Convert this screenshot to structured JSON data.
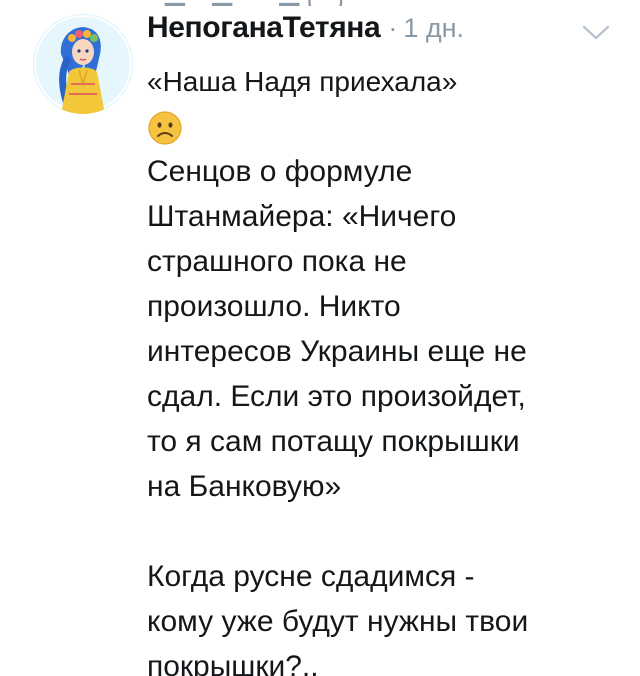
{
  "tweet": {
    "author_name": "НепоганаТетяна",
    "separator": "·",
    "time": "1 дн.",
    "first_line": "«Наша Надя приехала»",
    "emoji_icon": "sad-face-emoji",
    "quote_lines": [
      "Сенцов о формуле",
      "Штанмайера: «Ничего",
      "страшного пока не",
      "произошло. Никто",
      "интересов Украины еще не",
      "сдал. Если это произойдет,",
      "то я сам потащу покрышки",
      "на Банковую»"
    ],
    "reply_lines": [
      "Когда русне сдадимся -",
      "кому уже будут нужны твои",
      "покрышки?.."
    ]
  },
  "colors": {
    "text": "#14171a",
    "muted": "#8a99a6",
    "chevron": "#b7c4cf",
    "emoji": "#f5c242"
  },
  "icons": {
    "menu": "chevron-down-icon",
    "avatar": "avatar"
  }
}
